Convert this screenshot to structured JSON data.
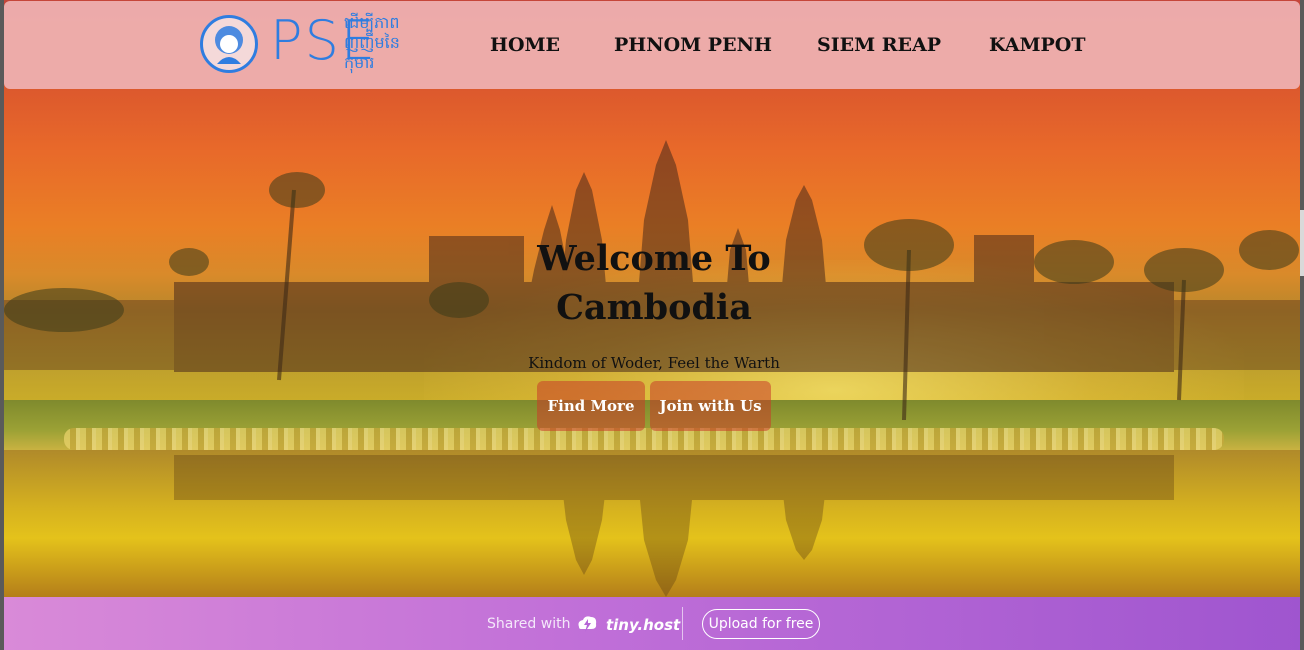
{
  "nav": {
    "logo_text": "PSE",
    "logo_sub": "ដើម្បីភាពញញឹមនៃកុមារ",
    "items": [
      {
        "label": "HOME"
      },
      {
        "label": "PHNOM PENH"
      },
      {
        "label": "SIEM REAP"
      },
      {
        "label": "KAMPOT"
      }
    ]
  },
  "hero": {
    "title_line1": "Welcome To",
    "title_line2": "Cambodia",
    "subtitle": "Kindom of Woder, Feel the Warth",
    "buttons": [
      {
        "label": "Find More"
      },
      {
        "label": "Join with Us"
      }
    ]
  },
  "footer": {
    "shared_label": "Shared with",
    "brand": "tiny.host",
    "upload_label": "Upload for free"
  },
  "colors": {
    "nav_bg": "#eeb0b0",
    "logo_blue": "#2f7de0",
    "button_bg": "#c83c28",
    "footer_start": "#d98ad8",
    "footer_end": "#9f55cf"
  },
  "icons": [
    "logo-portrait-icon",
    "tiny-host-bolt-icon"
  ]
}
